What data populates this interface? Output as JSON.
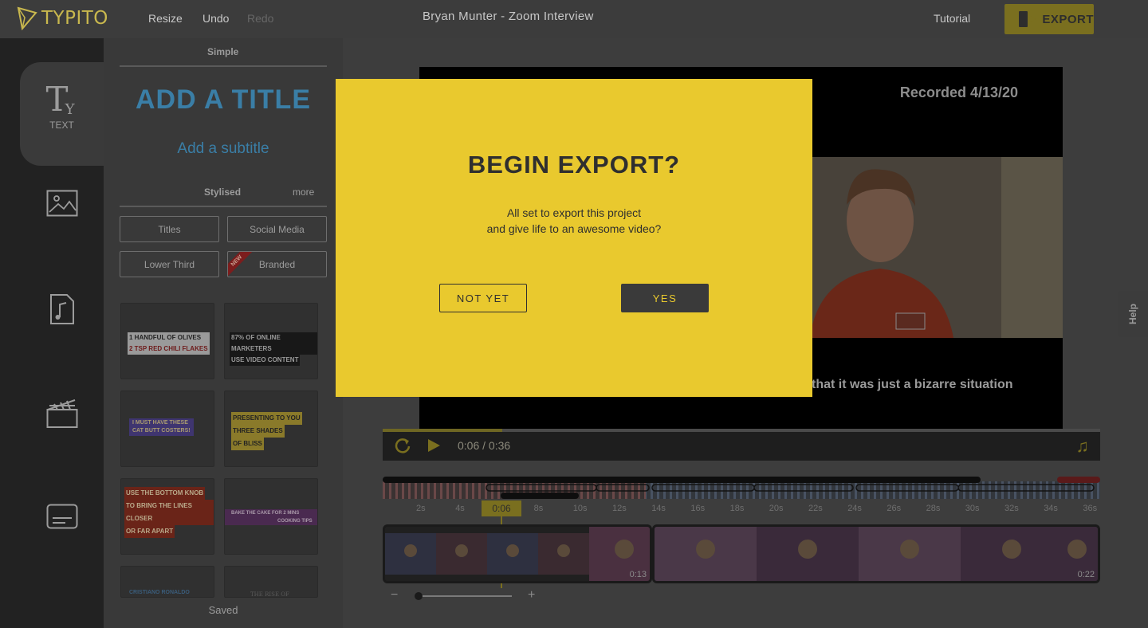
{
  "app": {
    "logo_text": "TYPITO",
    "project_title": "Bryan Munter - Zoom Interview"
  },
  "toolbar": {
    "resize": "Resize",
    "undo": "Undo",
    "redo": "Redo",
    "tutorial": "Tutorial",
    "export": "EXPORT"
  },
  "sidebar": {
    "items": [
      {
        "label": "TEXT",
        "icon": "text-icon",
        "active": true
      },
      {
        "label": "",
        "icon": "image-icon"
      },
      {
        "label": "",
        "icon": "music-file-icon"
      },
      {
        "label": "",
        "icon": "clapperboard-icon"
      },
      {
        "label": "",
        "icon": "subtitle-icon"
      }
    ]
  },
  "panel": {
    "simple_heading": "Simple",
    "add_title": "ADD A TITLE",
    "add_subtitle": "Add a subtitle",
    "stylised_heading": "Stylised",
    "more": "more",
    "categories": [
      "Titles",
      "Social Media",
      "Lower Third",
      "Branded"
    ],
    "new_badge": "NEW",
    "templates": [
      {
        "lines": [
          "1 HANDFUL OF OLIVES",
          "2 TSP RED CHILI FLAKES"
        ]
      },
      {
        "lines": [
          "87% OF ONLINE MARKETERS",
          "USE VIDEO CONTENT"
        ]
      },
      {
        "lines": [
          "I MUST HAVE THESE",
          "CAT BUTT COSTERS!"
        ]
      },
      {
        "lines": [
          "PRESENTING TO YOU",
          "THREE SHADES",
          "OF BLISS"
        ]
      },
      {
        "lines": [
          "USE THE BOTTOM KNOB",
          "TO BRING THE LINES CLOSER",
          "OR FAR APART"
        ]
      },
      {
        "lines": [
          "BAKE THE CAKE FOR 2 MINS",
          "COOKING TIPS"
        ]
      },
      {
        "lines": [
          "CRISTIANO RONALDO"
        ]
      },
      {
        "lines": [
          "THE RISE OF"
        ]
      }
    ],
    "saved": "Saved"
  },
  "preview": {
    "recorded_text": "Recorded 4/13/20",
    "caption": "that it was just a bizarre situation",
    "current_time": "0:06",
    "separator": "/",
    "duration": "0:36",
    "progress_fraction": 0.167
  },
  "timeline": {
    "playhead_label": "0:06",
    "ticks": [
      "2s",
      "4s",
      "0:06",
      "8s",
      "10s",
      "12s",
      "14s",
      "16s",
      "18s",
      "20s",
      "22s",
      "24s",
      "26s",
      "28s",
      "30s",
      "32s",
      "34s",
      "36s"
    ],
    "clips": [
      {
        "duration_label": "0:13"
      },
      {
        "duration_label": "0:22"
      }
    ],
    "zoom_minus": "−",
    "zoom_plus": "+"
  },
  "help": {
    "label": "Help"
  },
  "modal": {
    "title": "BEGIN EXPORT?",
    "line1": "All set to export this project",
    "line2": "and give life to an awesome video?",
    "cancel_label": "NOT YET",
    "confirm_label": "YES"
  },
  "colors": {
    "accent": "#e9c92e",
    "dim_accent": "#7a6f1f",
    "link_blue": "#3a7ea6",
    "dark": "#2f2f2f"
  }
}
